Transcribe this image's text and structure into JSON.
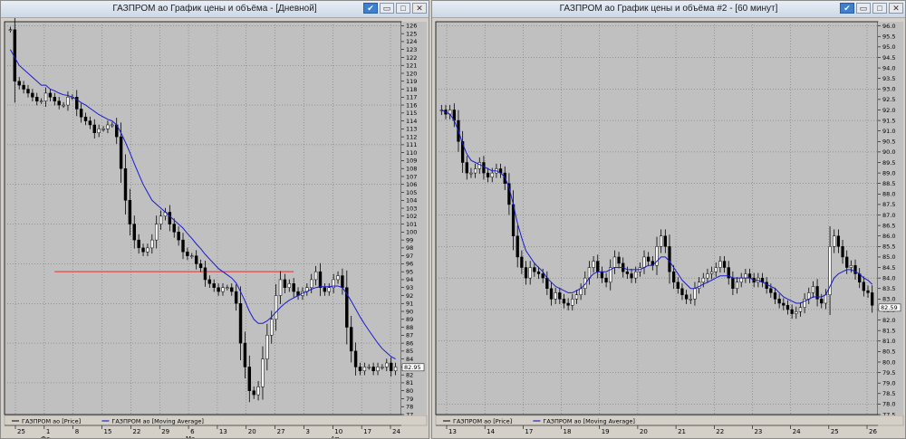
{
  "windows": [
    {
      "title": "ГАЗПРОМ ао График цены и объёма - [Дневной]",
      "legend": [
        {
          "label": "ГАЗПРОМ ао [Price]",
          "color": "#000000"
        },
        {
          "label": "ГАЗПРОМ ао [Moving Average]",
          "color": "#0000cc"
        }
      ],
      "y_ticks": [
        "126",
        "125",
        "124",
        "123",
        "122",
        "121",
        "120",
        "119",
        "118",
        "117",
        "116",
        "115",
        "114",
        "113",
        "112",
        "111",
        "110",
        "109",
        "108",
        "107",
        "106",
        "105",
        "104",
        "103",
        "102",
        "101",
        "100",
        "99",
        "98",
        "97",
        "96",
        "95",
        "94",
        "93",
        "92",
        "91",
        "90",
        "89",
        "88",
        "87",
        "86",
        "85",
        "84",
        "83",
        "82",
        "81",
        "80",
        "79",
        "78",
        "77"
      ],
      "price_tag": "82.95",
      "x_ticks": [
        "25",
        "1",
        "8",
        "15",
        "22",
        "29",
        "6",
        "13",
        "20",
        "27",
        "3",
        "10",
        "17",
        "24"
      ],
      "month_labels": [
        "Фе",
        "Ма",
        "Ап"
      ]
    },
    {
      "title": "ГАЗПРОМ ао График цены и объёма #2 - [60 минут]",
      "legend": [
        {
          "label": "ГАЗПРОМ ао [Price]",
          "color": "#000000"
        },
        {
          "label": "ГАЗПРОМ ао [Moving Average]",
          "color": "#0000cc"
        }
      ],
      "y_ticks": [
        "96.0",
        "95.5",
        "95.0",
        "94.5",
        "94.0",
        "93.5",
        "93.0",
        "92.5",
        "92.0",
        "91.5",
        "91.0",
        "90.5",
        "90.0",
        "89.5",
        "89.0",
        "88.5",
        "88.0",
        "87.5",
        "87.0",
        "86.5",
        "86.0",
        "85.5",
        "85.0",
        "84.5",
        "84.0",
        "83.5",
        "83.0",
        "82.5",
        "82.0",
        "81.5",
        "81.0",
        "80.5",
        "80.0",
        "79.5",
        "79.0",
        "78.5",
        "78.0",
        "77.5"
      ],
      "price_tag": "82.59",
      "x_ticks": [
        "13",
        "14",
        "17",
        "18",
        "19",
        "20",
        "21",
        "22",
        "23",
        "24",
        "25",
        "26"
      ]
    }
  ],
  "chart_data": [
    {
      "type": "candlestick",
      "title": "ГАЗПРОМ ао График цены и объёма - [Дневной]",
      "ylim": [
        77,
        126.5
      ],
      "series": [
        {
          "name": "ГАЗПРОМ ао [Price]",
          "values": [
            125.5,
            119,
            118.5,
            118,
            117.5,
            117,
            116.5,
            116.5,
            117.5,
            117,
            116.5,
            116,
            116,
            117,
            117,
            115.5,
            114.5,
            114,
            113.5,
            112.5,
            113,
            113,
            113.5,
            113.5,
            112,
            108,
            104,
            101,
            99,
            98,
            97.5,
            98,
            99,
            101,
            102,
            102.5,
            101,
            100,
            99,
            97.5,
            97,
            97,
            96,
            95.5,
            94,
            93.5,
            93,
            92.5,
            93,
            93,
            92.5,
            91,
            86,
            83,
            80,
            79.5,
            80.5,
            84,
            87,
            89,
            92,
            94,
            93,
            93.5,
            92.5,
            92,
            92.5,
            93,
            94,
            95,
            93,
            92.5,
            93,
            94,
            94.5,
            93,
            88,
            85,
            83,
            82.5,
            83,
            83,
            82.5,
            83,
            83,
            83.5,
            82.5,
            83
          ]
        },
        {
          "name": "ГАЗПРОМ ао [Moving Average]",
          "values": [
            123,
            122,
            121,
            120.5,
            120,
            119.5,
            119,
            118.5,
            118.5,
            118,
            117.8,
            117.5,
            117.3,
            117.2,
            117,
            116.7,
            116.3,
            116,
            115.6,
            115.2,
            114.8,
            114.5,
            114.2,
            114,
            113.5,
            112.5,
            111.3,
            110,
            108.6,
            107.3,
            106,
            105,
            104,
            103.5,
            103,
            102.5,
            102,
            101.5,
            101,
            100.5,
            99.8,
            99.2,
            98.5,
            97.9,
            97.2,
            96.6,
            96,
            95.4,
            95,
            94.6,
            94.2,
            93.6,
            92.5,
            91.3,
            90,
            89,
            88.5,
            88.5,
            88.8,
            89.3,
            89.9,
            90.5,
            91,
            91.4,
            91.7,
            92,
            92.3,
            92.5,
            92.8,
            93,
            93.1,
            93.1,
            93.1,
            93.2,
            93.2,
            93,
            92.2,
            91.3,
            90.3,
            89.3,
            88.4,
            87.6,
            86.8,
            86,
            85.3,
            84.8,
            84.3,
            84
          ]
        }
      ],
      "hline": 95,
      "last_price": 82.95
    },
    {
      "type": "candlestick",
      "title": "ГАЗПРОМ ао График цены и объёма #2 - [60 минут]",
      "ylim": [
        77.5,
        96.2
      ],
      "series": [
        {
          "name": "ГАЗПРОМ ао [Price]",
          "values": [
            92,
            91.8,
            92,
            91.5,
            90.5,
            89.5,
            89,
            89,
            89.2,
            89.5,
            89,
            88.8,
            89,
            89.2,
            89,
            88.5,
            87.5,
            86,
            85,
            84.5,
            84,
            84.5,
            84.3,
            84.2,
            84,
            83.5,
            83,
            83.3,
            83,
            82.8,
            82.7,
            83,
            83.2,
            83.5,
            84,
            84.5,
            84.8,
            84.3,
            84,
            83.8,
            84.5,
            85,
            84.7,
            84.3,
            84.2,
            84,
            84.3,
            84.5,
            85,
            84.8,
            84.6,
            85.5,
            86,
            85.5,
            84.3,
            83.8,
            83.5,
            83.2,
            83,
            83,
            83.5,
            83.8,
            84,
            84.2,
            84.3,
            84.5,
            84.8,
            84.5,
            84,
            83.5,
            83.8,
            84,
            84.2,
            84,
            83.8,
            84,
            83.8,
            83.5,
            83.3,
            83,
            82.8,
            82.7,
            82.5,
            82.3,
            82.4,
            82.6,
            83,
            83.3,
            83.6,
            83,
            82.8,
            83.2,
            85.5,
            86,
            85.5,
            85,
            84.5,
            84.6,
            84.2,
            83.8,
            83.4,
            83.3,
            82.7
          ]
        },
        {
          "name": "ГАЗПРОМ ао [Moving Average]",
          "values": [
            92,
            91.9,
            91.8,
            91.5,
            91,
            90.4,
            89.9,
            89.6,
            89.5,
            89.4,
            89.3,
            89.2,
            89.1,
            89.1,
            89,
            88.8,
            88.3,
            87.5,
            86.6,
            85.9,
            85.3,
            85,
            84.7,
            84.5,
            84.3,
            84,
            83.8,
            83.6,
            83.5,
            83.4,
            83.3,
            83.3,
            83.4,
            83.5,
            83.7,
            84,
            84.2,
            84.3,
            84.3,
            84.3,
            84.4,
            84.5,
            84.5,
            84.5,
            84.4,
            84.4,
            84.4,
            84.4,
            84.5,
            84.6,
            84.6,
            84.8,
            85,
            85,
            84.8,
            84.5,
            84.2,
            83.9,
            83.7,
            83.5,
            83.5,
            83.6,
            83.7,
            83.8,
            83.9,
            84,
            84.1,
            84.1,
            84.1,
            84,
            84,
            84,
            84,
            84,
            83.9,
            83.9,
            83.8,
            83.7,
            83.6,
            83.5,
            83.3,
            83.1,
            83,
            82.9,
            82.8,
            82.8,
            82.9,
            83,
            83.1,
            83.1,
            83.1,
            83.2,
            83.6,
            84,
            84.2,
            84.3,
            84.4,
            84.4,
            84.3,
            84.2,
            84,
            83.9,
            83.7
          ]
        }
      ],
      "last_price": 82.59
    }
  ]
}
